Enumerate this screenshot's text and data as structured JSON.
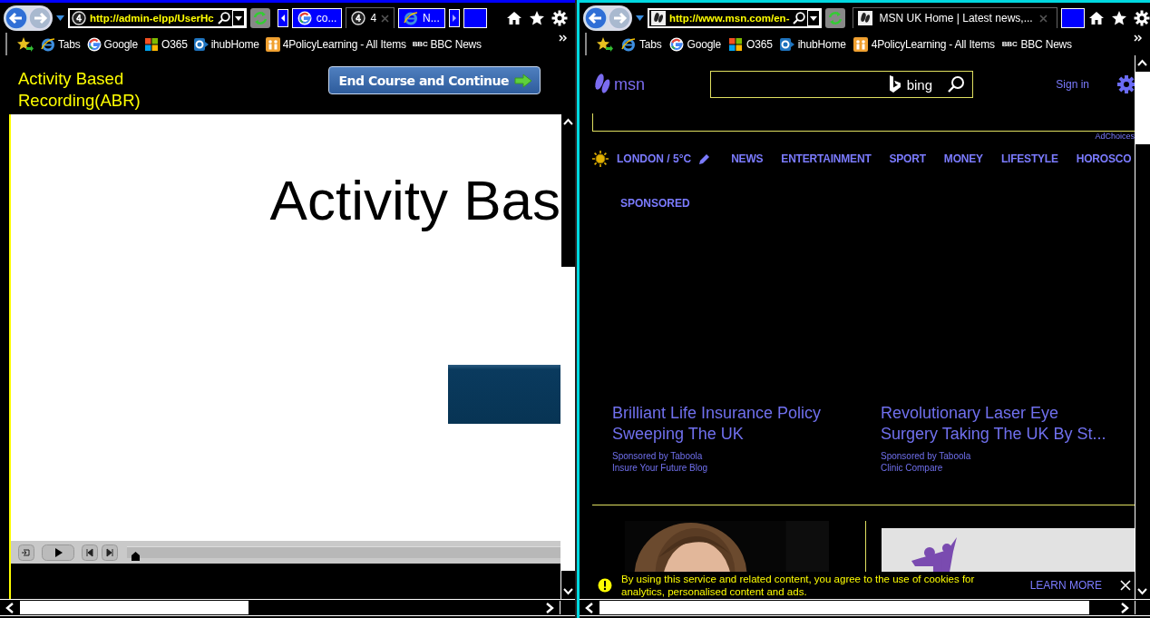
{
  "windows": [
    {
      "kind": "course",
      "address": "http://admin-elpp/UserHc",
      "tabs": [
        {
          "label": "co...",
          "kind": "google",
          "selected": false
        },
        {
          "label": "4",
          "kind": "site",
          "selected": true
        },
        {
          "label": "N...",
          "kind": "ie",
          "selected": false
        }
      ],
      "favorites": [
        {
          "label": "Tabs",
          "kind": "ie"
        },
        {
          "label": "Google",
          "kind": "google"
        },
        {
          "label": "O365",
          "kind": "office"
        },
        {
          "label": "ihubHome",
          "kind": "sharepoint"
        },
        {
          "label": "4PolicyLearning - All Items",
          "kind": "people"
        },
        {
          "label": "BBC News",
          "kind": "bbc",
          "badge": "BBC"
        }
      ],
      "page": {
        "title": "Activity Based Recording(ABR)",
        "action": "End Course and Continue",
        "slide_heading": "Activity Bas",
        "player": {
          "level": 0.01
        }
      }
    },
    {
      "kind": "news",
      "address": "http://www.msn.com/en-",
      "tabs": [
        {
          "label": "MSN UK Home | Latest news,...",
          "kind": "msn",
          "selected": true
        }
      ],
      "favorites": [
        {
          "label": "Tabs",
          "kind": "ie"
        },
        {
          "label": "Google",
          "kind": "google"
        },
        {
          "label": "O365",
          "kind": "office"
        },
        {
          "label": "ihubHome",
          "kind": "sharepoint"
        },
        {
          "label": "4PolicyLearning - All Items",
          "kind": "people"
        },
        {
          "label": "BBC News",
          "kind": "bbc",
          "badge": "BBC"
        }
      ],
      "page": {
        "logo": "msn",
        "search_brand": "bing",
        "sign_in": "Sign in",
        "ad_label": "AdChoices",
        "weather": "LONDON / 5°C",
        "nav": [
          "NEWS",
          "ENTERTAINMENT",
          "SPORT",
          "MONEY",
          "LIFESTYLE",
          "HOROSCO"
        ],
        "section": "SPONSORED",
        "articles": [
          {
            "title": "Brilliant Life Insurance Policy Sweeping The UK",
            "sponsor": "Sponsored by Taboola",
            "source": "Insure Your Future Blog"
          },
          {
            "title": "Revolutionary Laser Eye Surgery Taking The UK By St...",
            "sponsor": "Sponsored by Taboola",
            "source": "Clinic Compare"
          }
        ],
        "cookie": {
          "text": "By using this service and related content, you agree to the use of cookies for analytics, personalised content and ads.",
          "link": "LEARN MORE"
        }
      }
    }
  ]
}
